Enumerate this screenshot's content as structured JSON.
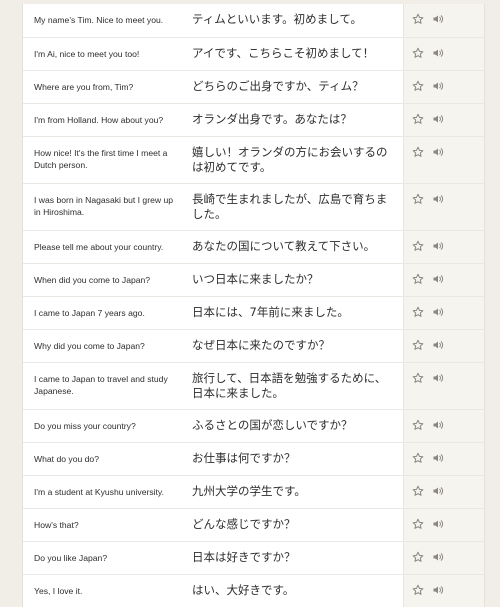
{
  "colors": {
    "background": "#f1eee8",
    "table": "#ffffff",
    "action_column": "#f6f4ef",
    "icon": "#8a8680"
  },
  "icons": {
    "favorite": "star-outline-icon",
    "audio": "speaker-icon"
  },
  "sentences": [
    {
      "en": "My name's Tim. Nice to meet you.",
      "ja": "ティムといいます。初めまして。"
    },
    {
      "en": "I'm Ai, nice to meet you too!",
      "ja": "アイです、こちらこそ初めまして！"
    },
    {
      "en": "Where are you from, Tim?",
      "ja": "どちらのご出身ですか、ティム？"
    },
    {
      "en": "I'm from Holland. How about you?",
      "ja": "オランダ出身です。あなたは？"
    },
    {
      "en": "How nice! It's the first time I meet a Dutch person.",
      "ja": "嬉しい！オランダの方にお会いするのは初めてです。"
    },
    {
      "en": "I was born in Nagasaki but I grew up in Hiroshima.",
      "ja": "長崎で生まれましたが、広島で育ちました。"
    },
    {
      "en": "Please tell me about your country.",
      "ja": "あなたの国について教えて下さい。"
    },
    {
      "en": "When did you come to Japan?",
      "ja": "いつ日本に来ましたか？"
    },
    {
      "en": "I came to Japan 7 years ago.",
      "ja": "日本には、7年前に来ました。"
    },
    {
      "en": "Why did you come to Japan?",
      "ja": "なぜ日本に来たのですか？"
    },
    {
      "en": "I came to Japan to travel and study Japanese.",
      "ja": "旅行して、日本語を勉強するために、日本に来ました。"
    },
    {
      "en": "Do you miss your country?",
      "ja": "ふるさとの国が恋しいですか？"
    },
    {
      "en": "What do you do?",
      "ja": "お仕事は何ですか？"
    },
    {
      "en": "I'm a student at Kyushu university.",
      "ja": "九州大学の学生です。"
    },
    {
      "en": "How's that?",
      "ja": "どんな感じですか？"
    },
    {
      "en": "Do you like Japan?",
      "ja": "日本は好きですか？"
    },
    {
      "en": "Yes, I love it.",
      "ja": "はい、大好きです。"
    }
  ]
}
